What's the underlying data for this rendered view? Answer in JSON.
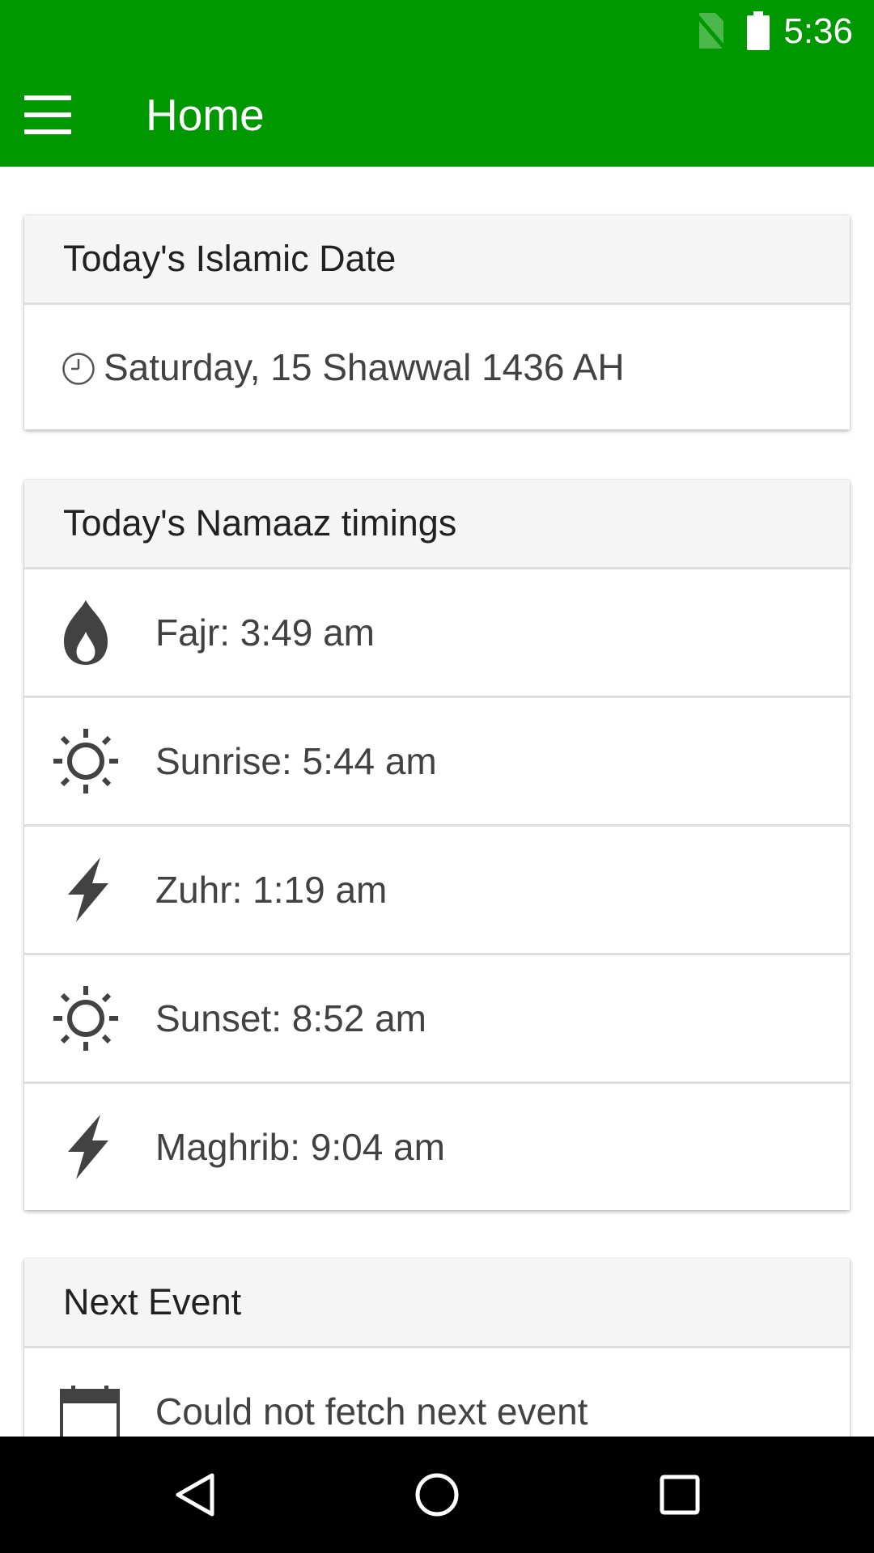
{
  "status_bar": {
    "time": "5:36"
  },
  "toolbar": {
    "title": "Home"
  },
  "islamic_date_card": {
    "header": "Today's Islamic Date",
    "date": "Saturday, 15 Shawwal 1436 AH"
  },
  "namaaz_card": {
    "header": "Today's Namaaz timings",
    "rows": [
      {
        "icon": "flame-icon",
        "label": "Fajr: 3:49 am"
      },
      {
        "icon": "sun-icon",
        "label": "Sunrise: 5:44 am"
      },
      {
        "icon": "lightning-icon",
        "label": "Zuhr: 1:19 am"
      },
      {
        "icon": "sun-icon",
        "label": "Sunset: 8:52 am"
      },
      {
        "icon": "lightning-icon",
        "label": "Maghrib: 9:04 am"
      }
    ]
  },
  "next_event_card": {
    "header": "Next Event",
    "message": "Could not fetch next event"
  },
  "colors": {
    "accent": "#009800",
    "text": "#424242"
  }
}
